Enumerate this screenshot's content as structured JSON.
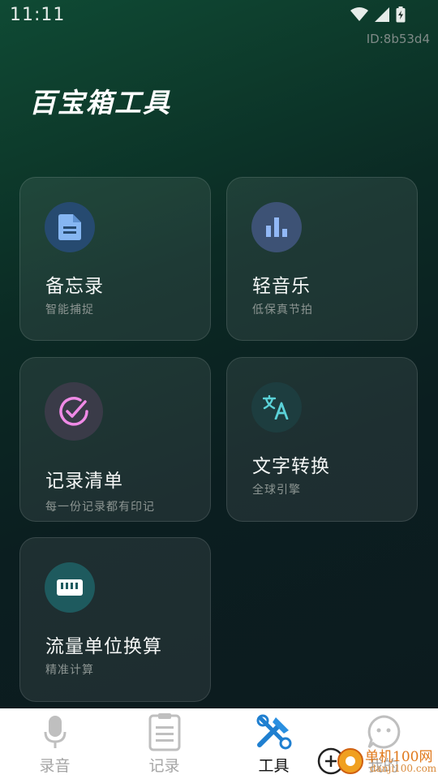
{
  "status_bar": {
    "time": "11:11"
  },
  "device_id": "ID:8b53d4",
  "page_title": "百宝箱工具",
  "cards": [
    {
      "title": "备忘录",
      "subtitle": "智能捕捉",
      "icon": "document-icon",
      "icon_bg": "#2a4a6e",
      "icon_color": "#7fb0f0"
    },
    {
      "title": "轻音乐",
      "subtitle": "低保真节拍",
      "icon": "bar-chart-icon",
      "icon_bg": "#3b4e70",
      "icon_color": "#8fb4f5"
    },
    {
      "title": "记录清单",
      "subtitle": "每一份记录都有印记",
      "icon": "check-circle-icon",
      "icon_bg": "#3a3a4a",
      "icon_color": "#f08ae0"
    },
    {
      "title": "文字转换",
      "subtitle": "全球引擎",
      "icon": "translate-icon",
      "icon_bg": "#1e3e40",
      "icon_color": "#5ad0d6"
    },
    {
      "title": "流量单位换算",
      "subtitle": "精准计算",
      "icon": "keyboard-icon",
      "icon_bg": "#1e5a5e",
      "icon_color": "#ffffff"
    }
  ],
  "nav": [
    {
      "label": "录音",
      "icon": "microphone-icon",
      "active": false
    },
    {
      "label": "记录",
      "icon": "clipboard-icon",
      "active": false
    },
    {
      "label": "工具",
      "icon": "tools-icon",
      "active": true
    },
    {
      "label": "我的",
      "icon": "chat-face-icon",
      "active": false
    }
  ],
  "watermark": {
    "text": "单机100网",
    "url": "danji100.com"
  }
}
